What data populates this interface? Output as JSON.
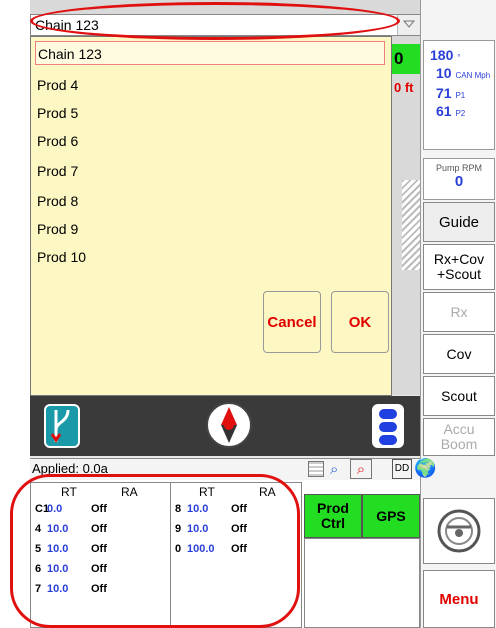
{
  "dropdown": {
    "selected_value": "Chain 123",
    "items": [
      "Chain 123",
      "Prod 4",
      "Prod 5",
      "Prod 6",
      "Prod 7",
      "Prod 8",
      "Prod 9",
      "Prod 10"
    ],
    "cancel_label": "Cancel",
    "ok_label": "OK"
  },
  "map": {
    "speed_digit": "0",
    "offset_label": "0 ft"
  },
  "right_panel": {
    "readouts": [
      {
        "value": "180",
        "unit": "°"
      },
      {
        "value": "10",
        "unit": "CAN Mph"
      },
      {
        "value": "71",
        "unit": "P1"
      },
      {
        "value": "61",
        "unit": "P2"
      }
    ],
    "pump_label": "Pump RPM",
    "pump_value": "0",
    "guide_label": "Guide",
    "rx_cov_scout_label": "Rx+Cov +Scout",
    "rx_label": "Rx",
    "cov_label": "Cov",
    "scout_label": "Scout",
    "accu_boom_label": "Accu Boom",
    "menu_label": "Menu"
  },
  "applied": {
    "text": "Applied: 0.0a"
  },
  "bottom_icons": {
    "dd_label": "DD"
  },
  "rate_table": {
    "headers": [
      "RT",
      "RA",
      "RT",
      "RA"
    ],
    "left_rows": [
      {
        "id": "C1",
        "target": "0.0",
        "actual": "Off"
      },
      {
        "id": "4",
        "target": "10.0",
        "actual": "Off"
      },
      {
        "id": "5",
        "target": "10.0",
        "actual": "Off"
      },
      {
        "id": "6",
        "target": "10.0",
        "actual": "Off"
      },
      {
        "id": "7",
        "target": "10.0",
        "actual": "Off"
      }
    ],
    "right_rows": [
      {
        "id": "8",
        "target": "10.0",
        "actual": "Off"
      },
      {
        "id": "9",
        "target": "10.0",
        "actual": "Off"
      },
      {
        "id": "0",
        "target": "100.0",
        "actual": "Off"
      }
    ]
  },
  "controls": {
    "prod_ctrl_label": "Prod Ctrl",
    "gps_label": "GPS"
  },
  "colors": {
    "accent_green": "#22dd22",
    "dropdown_bg": "#fdf7c3",
    "value_blue": "#2a3fd8",
    "highlight_red": "#e01010"
  }
}
